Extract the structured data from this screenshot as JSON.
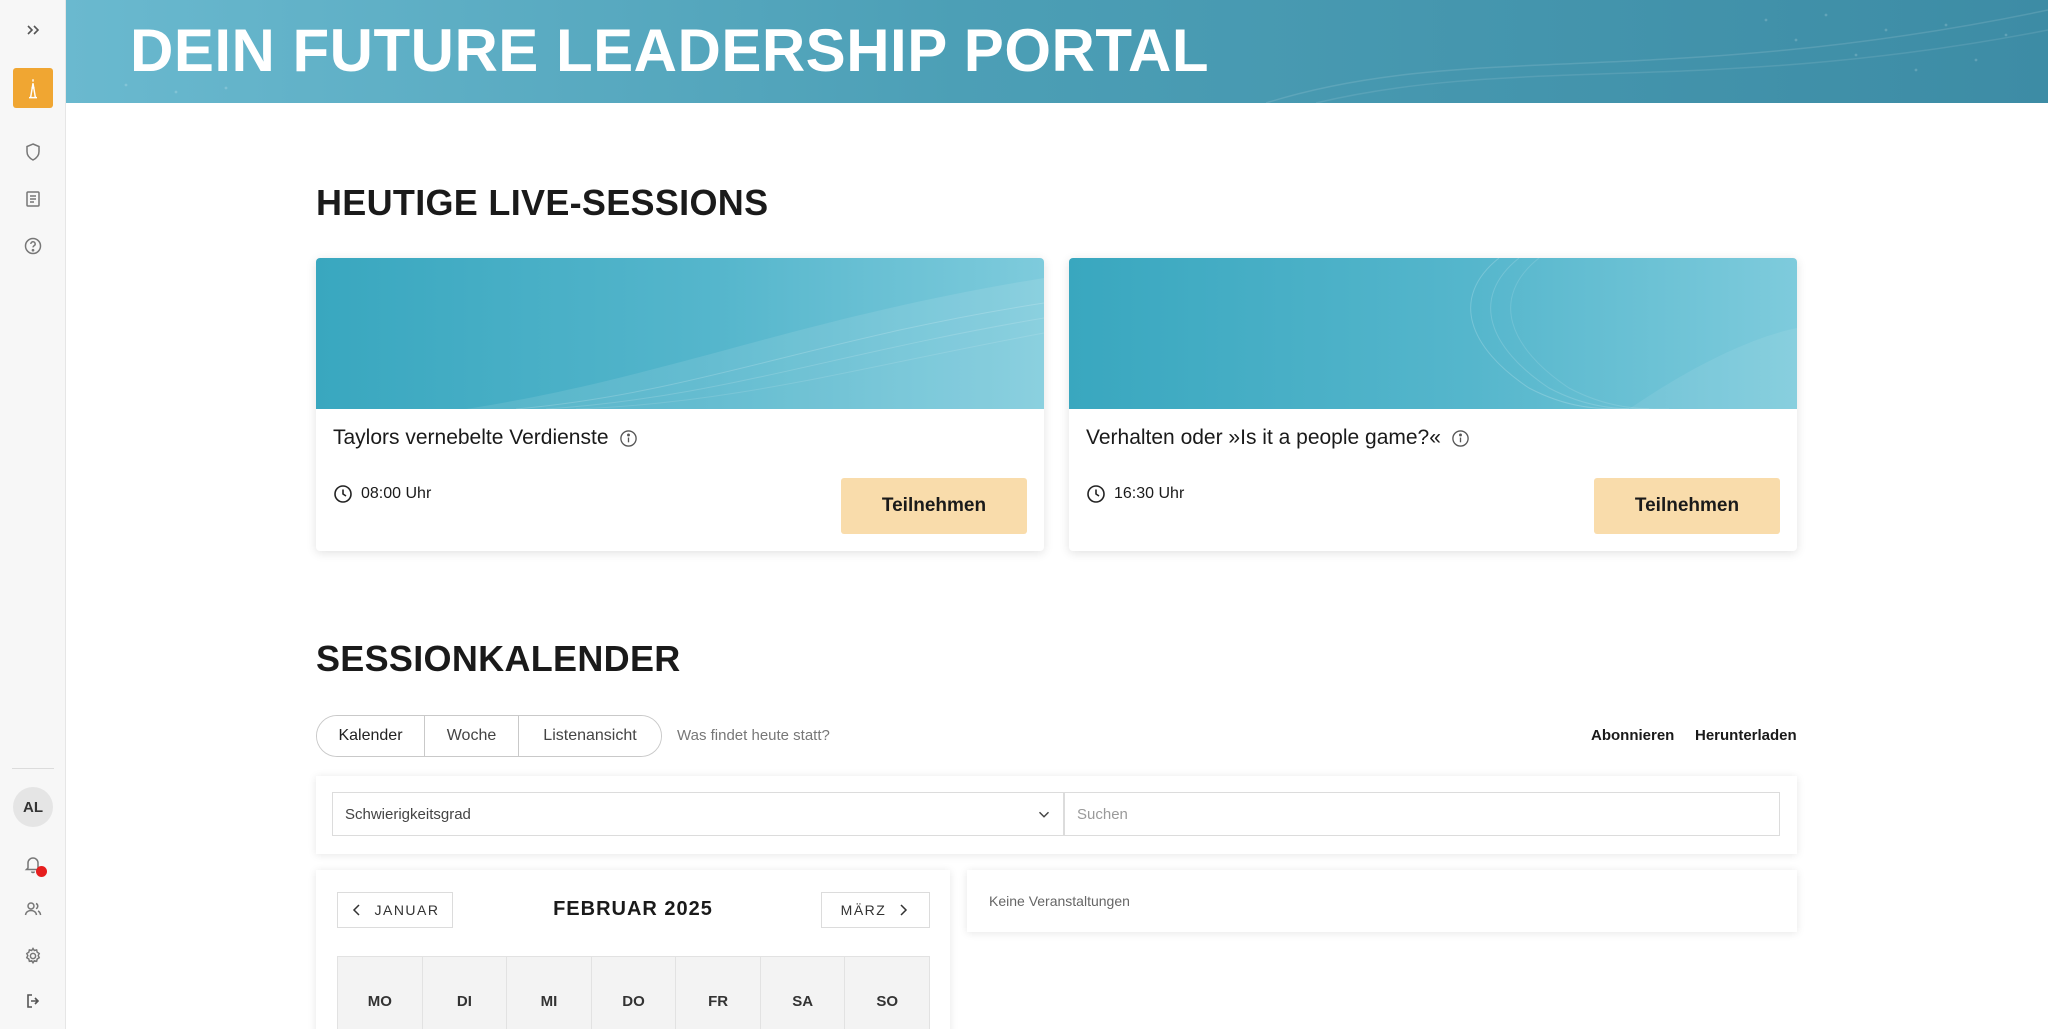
{
  "sidebar": {
    "expand_icon": "chevrons-right-icon",
    "logo_icon": "tower-logo-icon",
    "items": [
      {
        "icon": "shield-icon"
      },
      {
        "icon": "book-icon"
      },
      {
        "icon": "help-circle-icon"
      }
    ],
    "avatar_initials": "AL",
    "bottom_items": [
      {
        "icon": "bell-icon",
        "has_notification": true
      },
      {
        "icon": "users-icon"
      },
      {
        "icon": "gear-icon"
      },
      {
        "icon": "logout-icon"
      }
    ],
    "accent_color": "#f0a632",
    "notification_color": "#e61e1e"
  },
  "banner": {
    "title": "DEIN FUTURE LEADERSHIP PORTAL",
    "color": "#4c9fb6"
  },
  "live_sessions": {
    "heading": "HEUTIGE LIVE-SESSIONS",
    "cards": [
      {
        "title": "Taylors vernebelte Verdienste",
        "time": "08:00 Uhr",
        "button": "Teilnehmen"
      },
      {
        "title": "Verhalten oder »Is it a people game?«",
        "time": "16:30 Uhr",
        "button": "Teilnehmen"
      }
    ],
    "button_color": "#f9dcab"
  },
  "calendar_section": {
    "heading": "SESSIONKALENDER",
    "views": [
      {
        "label": "Kalender",
        "active": true
      },
      {
        "label": "Woche",
        "active": false
      },
      {
        "label": "Listenansicht",
        "active": false
      }
    ],
    "today_link": "Was findet heute statt?",
    "subscribe": "Abonnieren",
    "download": "Herunterladen",
    "filter": {
      "difficulty_selected": "Schwierigkeitsgrad",
      "search_placeholder": "Suchen"
    },
    "calendar": {
      "prev_month": "JANUAR",
      "current_month": "FEBRUAR 2025",
      "next_month": "MÄRZ",
      "weekdays": [
        "MO",
        "DI",
        "MI",
        "DO",
        "FR",
        "SA",
        "SO"
      ]
    },
    "events_empty": "Keine Veranstaltungen"
  }
}
